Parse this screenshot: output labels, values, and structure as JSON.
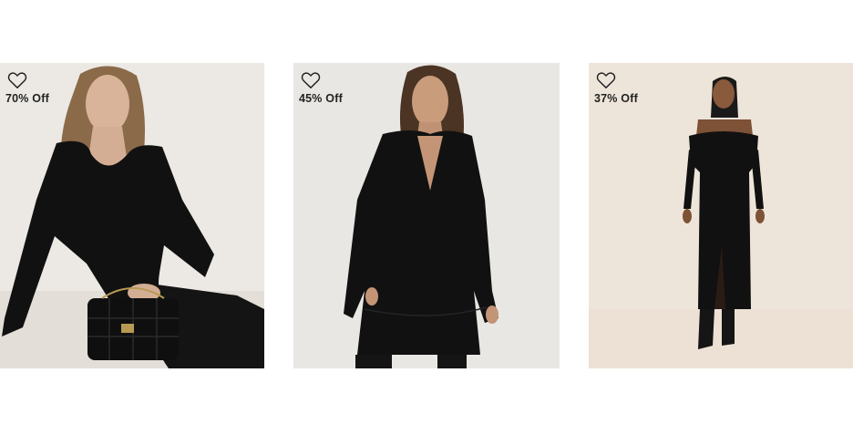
{
  "products": [
    {
      "discount_label": "70% Off",
      "icon": "heart-outline-icon",
      "image_alt": "Woman in black long-sleeve scoop-neck top seated with quilted black handbag"
    },
    {
      "discount_label": "45% Off",
      "icon": "heart-outline-icon",
      "image_alt": "Woman in black long-sleeve V-neck tiered mini dress"
    },
    {
      "discount_label": "37% Off",
      "icon": "heart-outline-icon",
      "image_alt": "Woman in black off-the-shoulder midi dress with black boots"
    }
  ],
  "colors": {
    "photo_bg_1": "#ece9e4",
    "photo_bg_2": "#e9e7e3",
    "photo_bg_3": "#eee5da",
    "garment": "#111111",
    "label_text": "#222222"
  }
}
